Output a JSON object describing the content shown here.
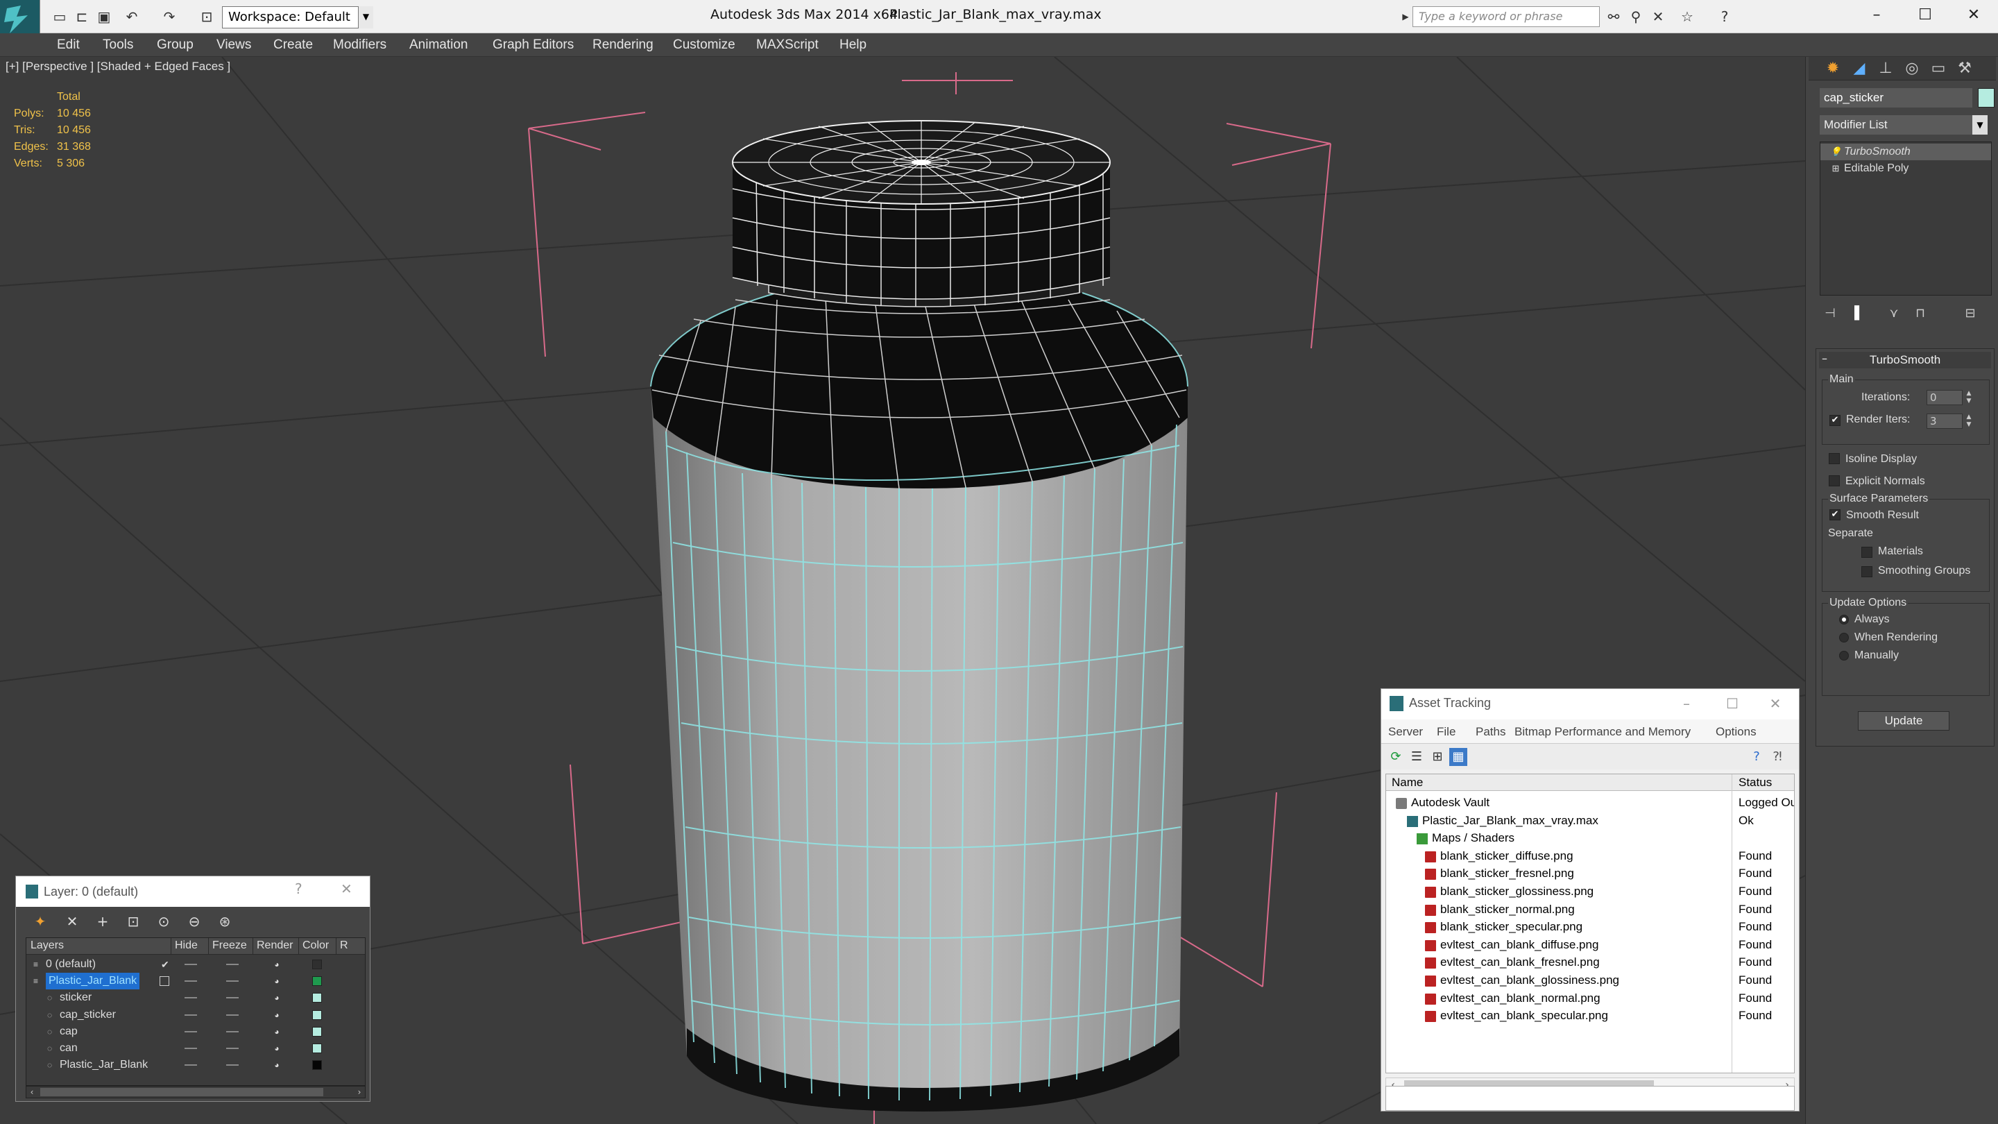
{
  "titlebar": {
    "app_title": "Autodesk 3ds Max  2014 x64",
    "file_title": "Plastic_Jar_Blank_max_vray.max",
    "workspace": "Workspace: Default",
    "search_placeholder": "Type a keyword or phrase"
  },
  "menu": [
    "Edit",
    "Tools",
    "Group",
    "Views",
    "Create",
    "Modifiers",
    "Animation",
    "Graph Editors",
    "Rendering",
    "Customize",
    "MAXScript",
    "Help"
  ],
  "viewport": {
    "label": "[+] [Perspective ] [Shaded + Edged Faces ]",
    "stats_header": "Total",
    "stats": [
      {
        "label": "Polys:",
        "value": "10 456"
      },
      {
        "label": "Tris:",
        "value": "10 456"
      },
      {
        "label": "Edges:",
        "value": "31 368"
      },
      {
        "label": "Verts:",
        "value": "5 306"
      }
    ]
  },
  "command_panel": {
    "object_name": "cap_sticker",
    "object_color": "#b5ece0",
    "modifier_list": "Modifier List",
    "stack": [
      "TurboSmooth",
      "Editable Poly"
    ],
    "rollout_title": "TurboSmooth",
    "main_group": "Main",
    "iterations_label": "Iterations:",
    "iterations_value": "0",
    "render_iters_label": "Render Iters:",
    "render_iters_value": "3",
    "render_iters_checked": true,
    "isoline_label": "Isoline Display",
    "explicit_normals_label": "Explicit Normals",
    "surface_group": "Surface Parameters",
    "smooth_result_label": "Smooth Result",
    "separate_label": "Separate",
    "materials_label": "Materials",
    "smoothing_groups_label": "Smoothing Groups",
    "update_group": "Update Options",
    "update_options": [
      "Always",
      "When Rendering",
      "Manually"
    ],
    "update_selected": "Always",
    "update_button": "Update"
  },
  "asset_tracking": {
    "title": "Asset Tracking",
    "menu": [
      "Server",
      "File",
      "Paths",
      "Bitmap Performance and Memory",
      "Options"
    ],
    "col_name": "Name",
    "col_status": "Status",
    "rows": [
      {
        "name": "Autodesk Vault",
        "status": "Logged Out",
        "level": 0,
        "icon": "vault"
      },
      {
        "name": "Plastic_Jar_Blank_max_vray.max",
        "status": "Ok",
        "level": 1,
        "icon": "max"
      },
      {
        "name": "Maps / Shaders",
        "status": "",
        "level": 2,
        "icon": "maps"
      },
      {
        "name": "blank_sticker_diffuse.png",
        "status": "Found",
        "level": 3,
        "icon": "png"
      },
      {
        "name": "blank_sticker_fresnel.png",
        "status": "Found",
        "level": 3,
        "icon": "png"
      },
      {
        "name": "blank_sticker_glossiness.png",
        "status": "Found",
        "level": 3,
        "icon": "png"
      },
      {
        "name": "blank_sticker_normal.png",
        "status": "Found",
        "level": 3,
        "icon": "png"
      },
      {
        "name": "blank_sticker_specular.png",
        "status": "Found",
        "level": 3,
        "icon": "png"
      },
      {
        "name": "evltest_can_blank_diffuse.png",
        "status": "Found",
        "level": 3,
        "icon": "png"
      },
      {
        "name": "evltest_can_blank_fresnel.png",
        "status": "Found",
        "level": 3,
        "icon": "png"
      },
      {
        "name": "evltest_can_blank_glossiness.png",
        "status": "Found",
        "level": 3,
        "icon": "png"
      },
      {
        "name": "evltest_can_blank_normal.png",
        "status": "Found",
        "level": 3,
        "icon": "png"
      },
      {
        "name": "evltest_can_blank_specular.png",
        "status": "Found",
        "level": 3,
        "icon": "png"
      }
    ]
  },
  "layer_panel": {
    "title": "Layer: 0 (default)",
    "help": "?",
    "columns": [
      "Layers",
      "Hide",
      "Freeze",
      "Render",
      "Color",
      "R"
    ],
    "rows": [
      {
        "name": "0 (default)",
        "level": 0,
        "color": "#2f2f2f",
        "selected": false,
        "active": true
      },
      {
        "name": "Plastic_Jar_Blank",
        "level": 0,
        "color": "#1f9a4e",
        "selected": true,
        "active": false
      },
      {
        "name": "sticker",
        "level": 1,
        "color": "#b5ece0",
        "selected": false,
        "active": false
      },
      {
        "name": "cap_sticker",
        "level": 1,
        "color": "#b5ece0",
        "selected": false,
        "active": false
      },
      {
        "name": "cap",
        "level": 1,
        "color": "#b5ece0",
        "selected": false,
        "active": false
      },
      {
        "name": "can",
        "level": 1,
        "color": "#b5ece0",
        "selected": false,
        "active": false
      },
      {
        "name": "Plastic_Jar_Blank",
        "level": 1,
        "color": "#050505",
        "selected": false,
        "active": false
      }
    ]
  }
}
